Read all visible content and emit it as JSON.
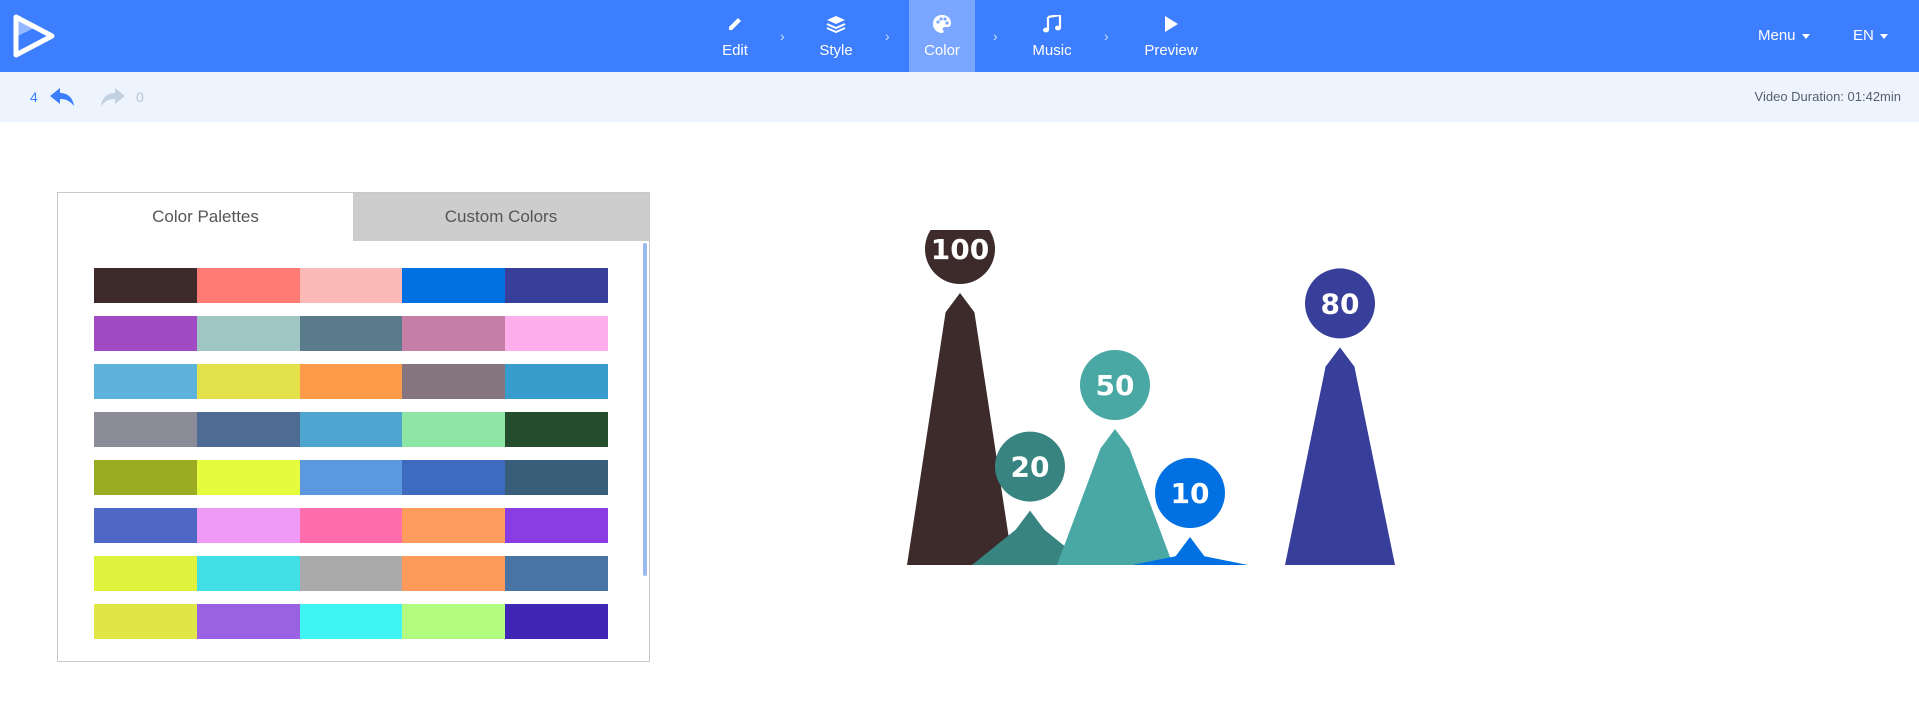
{
  "header": {
    "steps": [
      {
        "label": "Edit",
        "icon": "pencil-icon",
        "active": false
      },
      {
        "label": "Style",
        "icon": "layers-icon",
        "active": false
      },
      {
        "label": "Color",
        "icon": "palette-icon",
        "active": true
      },
      {
        "label": "Music",
        "icon": "music-note-icon",
        "active": false
      },
      {
        "label": "Preview",
        "icon": "play-icon",
        "active": false
      }
    ],
    "menu_label": "Menu",
    "language_label": "EN",
    "accent_color": "#3d7eff"
  },
  "history": {
    "undo_count": "4",
    "redo_count": "0",
    "duration_text": "Video Duration: 01:42min"
  },
  "panel": {
    "tabs": [
      {
        "label": "Color Palettes",
        "active": true
      },
      {
        "label": "Custom Colors",
        "active": false
      }
    ],
    "palettes": [
      [
        "#3d2b2b",
        "#ff7b73",
        "#fbb9b7",
        "#0070e2",
        "#373f9a"
      ],
      [
        "#a24ac4",
        "#a0c6c4",
        "#5a7b8b",
        "#c57fa7",
        "#ffaeec"
      ],
      [
        "#5db3dc",
        "#e4e24b",
        "#fe9b4a",
        "#85757f",
        "#389dcc"
      ],
      [
        "#8c8c99",
        "#4e6c93",
        "#4ea6d0",
        "#8de6a3",
        "#234d2d"
      ],
      [
        "#9aad22",
        "#e4fb3e",
        "#5b98de",
        "#3e6bc0",
        "#395e7a"
      ],
      [
        "#4f68c6",
        "#ef9bf5",
        "#ff6cac",
        "#fe9c5e",
        "#8a3de3"
      ],
      [
        "#e0f33c",
        "#41e0e7",
        "#aaaaaa",
        "#fe9a5a",
        "#4874a4"
      ],
      [
        "#e1e647",
        "#9b61e3",
        "#41f4f4",
        "#b2fd7f",
        "#4026b5"
      ]
    ]
  },
  "chart_data": {
    "type": "bar",
    "categories": [
      "100",
      "20",
      "50",
      "10",
      "80"
    ],
    "values": [
      100,
      20,
      50,
      10,
      80
    ],
    "labels": [
      "100",
      "20",
      "50",
      "10",
      "80"
    ],
    "colors": [
      "#3d2b2b",
      "#388481",
      "#4aa8a4",
      "#0070e2",
      "#373f9a"
    ],
    "title": "",
    "xlabel": "",
    "ylabel": ""
  }
}
